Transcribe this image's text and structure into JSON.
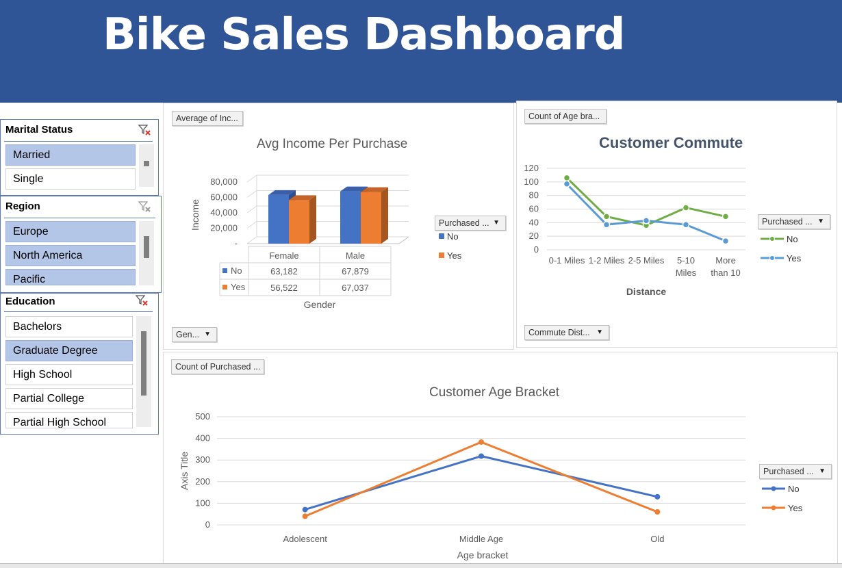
{
  "header": {
    "title": "Bike Sales Dashboard"
  },
  "colors": {
    "banner": "#2f5597",
    "no": "#4472c4",
    "yes": "#ed7d31",
    "commute_no": "#70ad47",
    "commute_yes": "#5b9bd5",
    "selected": "#b4c6e7"
  },
  "slicers": {
    "marital": {
      "title": "Marital Status",
      "icon": "clear-filter-icon",
      "items": [
        {
          "label": "Married",
          "selected": true
        },
        {
          "label": "Single",
          "selected": false
        }
      ]
    },
    "region": {
      "title": "Region",
      "icon": "clear-filter-icon",
      "items": [
        {
          "label": "Europe",
          "selected": true
        },
        {
          "label": "North America",
          "selected": true
        },
        {
          "label": "Pacific",
          "selected": true
        }
      ]
    },
    "education": {
      "title": "Education",
      "icon": "clear-filter-icon",
      "items": [
        {
          "label": "Bachelors",
          "selected": false
        },
        {
          "label": "Graduate Degree",
          "selected": true
        },
        {
          "label": "High School",
          "selected": false
        },
        {
          "label": "Partial College",
          "selected": false
        },
        {
          "label": "Partial High School",
          "selected": false
        }
      ]
    }
  },
  "income_chart": {
    "value_button": "Average of Inc...",
    "axis_button": "Gen...",
    "legend_button": "Purchased ...",
    "chart_data": {
      "type": "bar",
      "title": "Avg Income Per Purchase",
      "xlabel": "Gender",
      "ylabel": "Income",
      "categories": [
        "Female",
        "Male"
      ],
      "yticks": [
        "-",
        "20,000",
        "40,000",
        "60,000",
        "80,000"
      ],
      "ylim": [
        0,
        80000
      ],
      "series": [
        {
          "name": "No",
          "values": [
            63182,
            67879
          ],
          "labels": [
            "63,182",
            "67,879"
          ]
        },
        {
          "name": "Yes",
          "values": [
            56522,
            67037
          ],
          "labels": [
            "56,522",
            "67,037"
          ]
        }
      ]
    }
  },
  "commute_chart": {
    "value_button": "Count of Age bra...",
    "axis_button": "Commute Dist...",
    "legend_button": "Purchased ...",
    "chart_data": {
      "type": "line",
      "title": "Customer  Commute",
      "xlabel": "Distance",
      "categories": [
        "0-1 Miles",
        "1-2 Miles",
        "2-5 Miles",
        "5-10 Miles",
        "More than 10"
      ],
      "category_lines": [
        [
          "0-1 Miles"
        ],
        [
          "1-2 Miles"
        ],
        [
          "2-5 Miles"
        ],
        [
          "5-10",
          "Miles"
        ],
        [
          "More",
          "than 10"
        ]
      ],
      "ylim": [
        0,
        120
      ],
      "yticks": [
        0,
        20,
        40,
        60,
        80,
        100,
        120
      ],
      "series": [
        {
          "name": "No",
          "values": [
            106,
            49,
            36,
            62,
            49
          ]
        },
        {
          "name": "Yes",
          "values": [
            97,
            37,
            43,
            37,
            13
          ]
        }
      ]
    }
  },
  "age_chart": {
    "value_button": "Count of Purchased ...",
    "legend_button": "Purchased ...",
    "chart_data": {
      "type": "line",
      "title": "Customer Age Bracket",
      "xlabel": "Age bracket",
      "ylabel": "Axis Title",
      "categories": [
        "Adolescent",
        "Middle Age",
        "Old"
      ],
      "ylim": [
        0,
        500
      ],
      "yticks": [
        0,
        100,
        200,
        300,
        400,
        500
      ],
      "series": [
        {
          "name": "No",
          "values": [
            71,
            318,
            130
          ]
        },
        {
          "name": "Yes",
          "values": [
            40,
            383,
            60
          ]
        }
      ]
    }
  }
}
